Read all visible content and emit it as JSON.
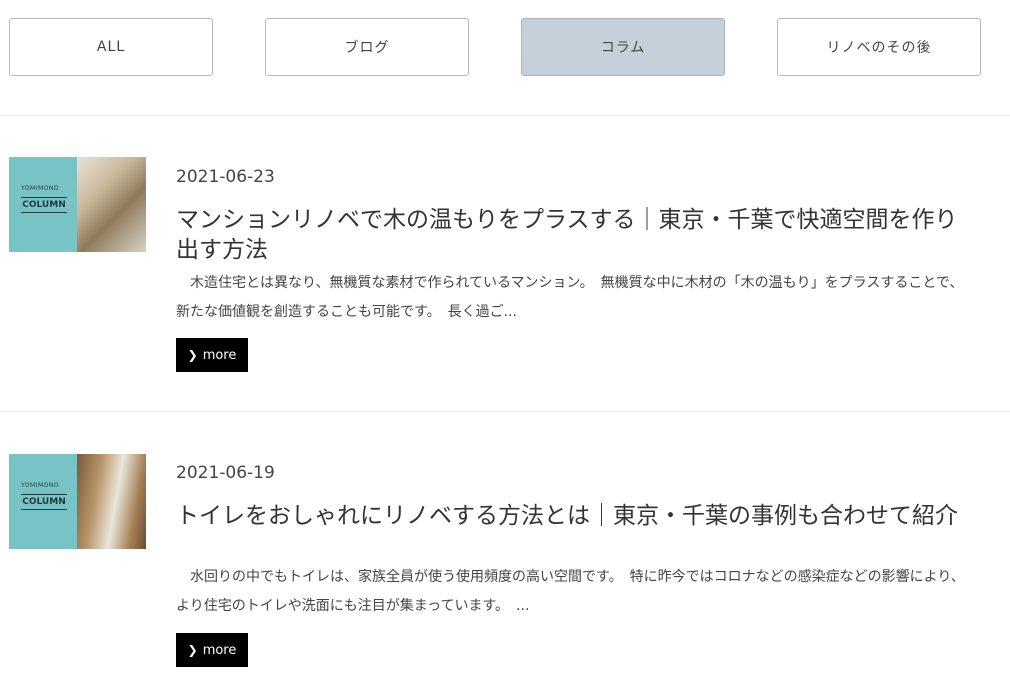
{
  "tabs": [
    {
      "label": "ALL",
      "active": false
    },
    {
      "label": "ブログ",
      "active": false
    },
    {
      "label": "コラム",
      "active": true
    },
    {
      "label": "リノベのその後",
      "active": false
    }
  ],
  "posts": [
    {
      "thumb_badge_small": "YOMIMONO",
      "thumb_badge_main": "COLUMN",
      "date": "2021-06-23",
      "title": "マンションリノベで木の温もりをプラスする｜東京・千葉で快適空間を作り出す方法",
      "excerpt": "　木造住宅とは異なり、無機質な素材で作られているマンション。　無機質な中に木材の「木の温もり」をプラスすることで、新たな価値観を創造することも可能です。　長く過ご...",
      "more_label": "more"
    },
    {
      "thumb_badge_small": "YOMIMONO",
      "thumb_badge_main": "COLUMN",
      "date": "2021-06-19",
      "title": "トイレをおしゃれにリノベする方法とは｜東京・千葉の事例も合わせて紹介",
      "excerpt": "　水回りの中でもトイレは、家族全員が使う使用頻度の高い空間です。　特に昨今ではコロナなどの感染症などの影響により、より住宅のトイレや洗面にも注目が集まっています。　...",
      "more_label": "more"
    }
  ],
  "colors": {
    "active_tab": "#c5d0da",
    "badge": "#78c3c6",
    "more_button": "#000000"
  }
}
